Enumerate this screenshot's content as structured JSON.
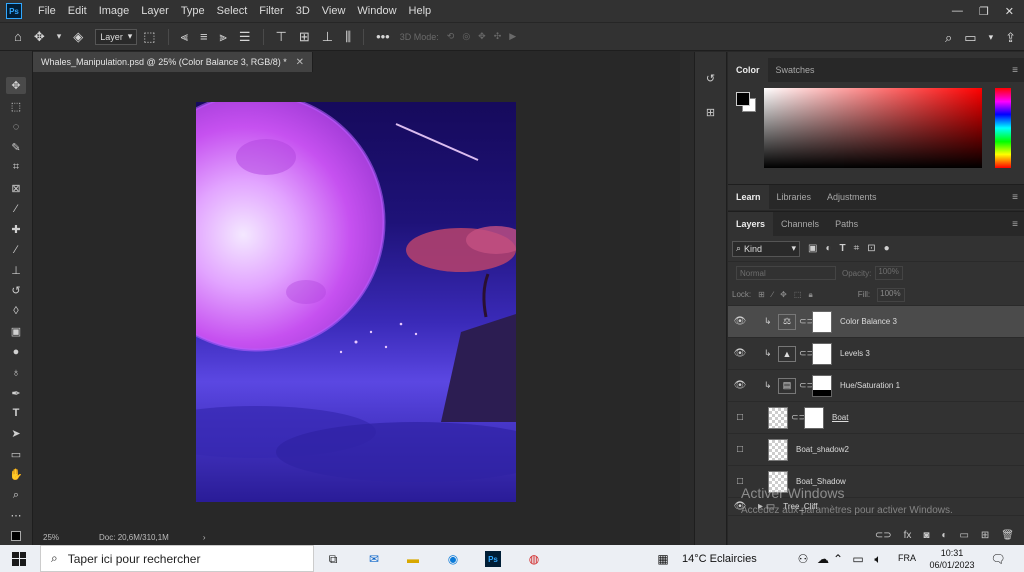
{
  "menubar": {
    "app_icon": "Ps",
    "items": [
      "File",
      "Edit",
      "Image",
      "Layer",
      "Type",
      "Select",
      "Filter",
      "3D",
      "View",
      "Window",
      "Help"
    ]
  },
  "options": {
    "auto_select": "Layer",
    "mode_3d": "3D Mode:"
  },
  "document": {
    "tab_title": "Whales_Manipulation.psd @ 25% (Color Balance 3, RGB/8) *",
    "zoom": "25%",
    "doc_info": "Doc: 20,6M/310,1M"
  },
  "panels": {
    "color_tabs": [
      "Color",
      "Swatches"
    ],
    "learn_tabs": [
      "Learn",
      "Libraries",
      "Adjustments"
    ],
    "layer_tabs": [
      "Layers",
      "Channels",
      "Paths"
    ],
    "filter_kind": "Kind",
    "blend_mode": "Normal",
    "opacity_label": "Opacity:",
    "opacity_value": "100%",
    "lock_label": "Lock:",
    "fill_label": "Fill:",
    "fill_value": "100%"
  },
  "layers": [
    {
      "name": "Color Balance 3",
      "icon": "balance-icon",
      "selected": true,
      "visible": true
    },
    {
      "name": "Levels 3",
      "icon": "levels-icon",
      "selected": false,
      "visible": true
    },
    {
      "name": "Hue/Saturation 1",
      "icon": "hue-sat-icon",
      "selected": false,
      "visible": true
    },
    {
      "name": "Boat",
      "icon": "pixel",
      "selected": false,
      "visible": false
    },
    {
      "name": "Boat_shadow2",
      "icon": "pixel",
      "selected": false,
      "visible": false
    },
    {
      "name": "Boat_Shadow",
      "icon": "pixel",
      "selected": false,
      "visible": false
    },
    {
      "name": "Tree_Cliff",
      "icon": "folder",
      "selected": false,
      "visible": true
    }
  ],
  "watermark": {
    "line1": "Activer Windows",
    "line2": "Accédez aux paramètres pour activer Windows."
  },
  "taskbar": {
    "search_placeholder": "Taper ici pour rechercher",
    "weather": "14°C  Eclaircies",
    "language": "FRA",
    "time": "10:31",
    "date": "06/01/2023"
  },
  "colors": {
    "accent": "#31a8ff",
    "panel_bg": "#323232",
    "canvas_bg": "#282828"
  }
}
